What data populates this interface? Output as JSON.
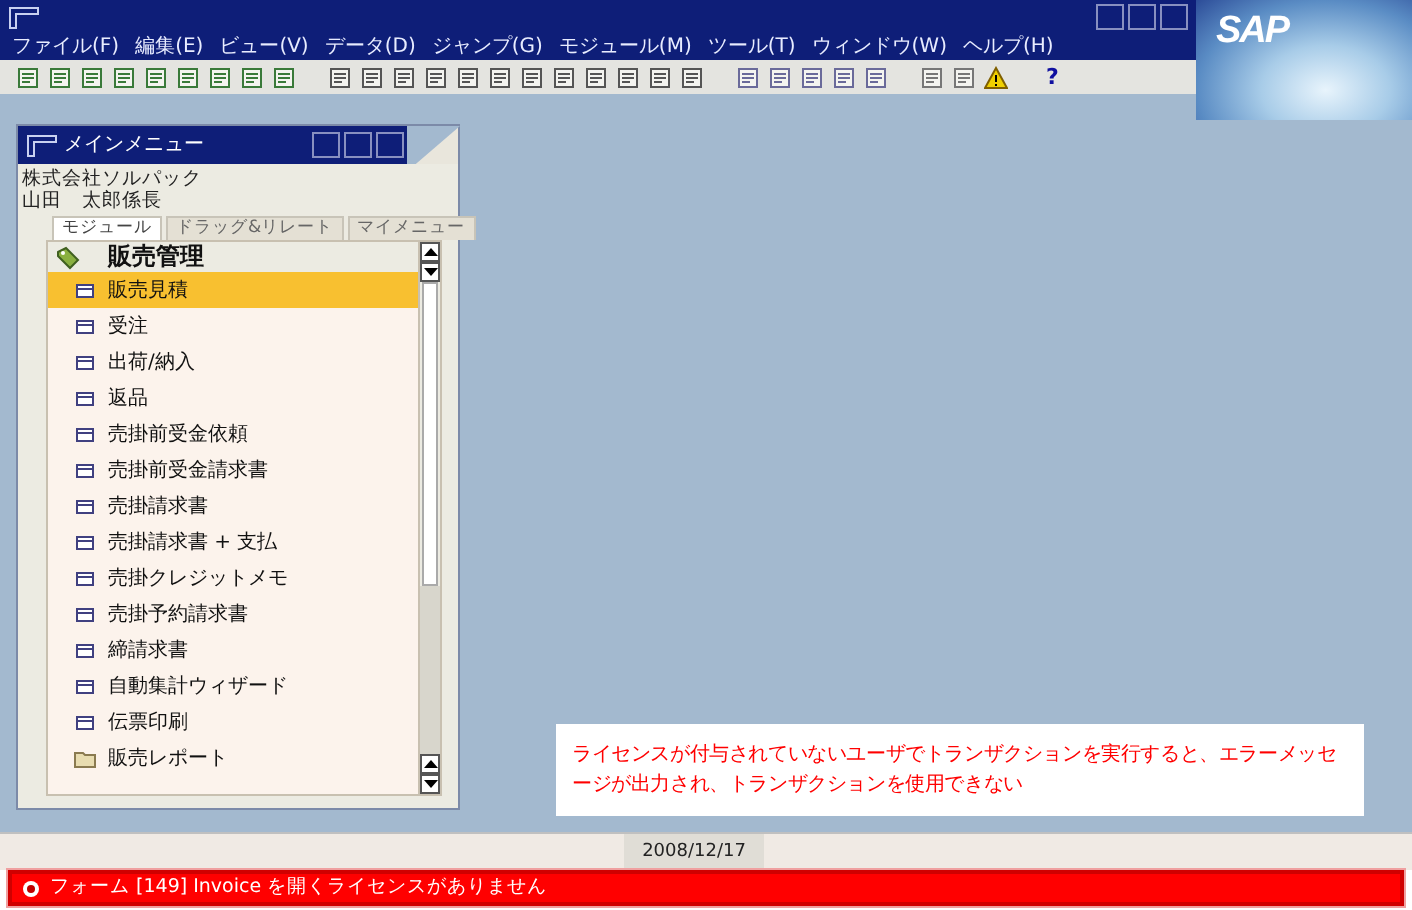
{
  "app": {
    "logo": "SAP"
  },
  "menu_bar": [
    {
      "label": "ファイル(F)"
    },
    {
      "label": "編集(E)"
    },
    {
      "label": "ビュー(V)"
    },
    {
      "label": "データ(D)"
    },
    {
      "label": "ジャンプ(G)"
    },
    {
      "label": "モジュール(M)"
    },
    {
      "label": "ツール(T)"
    },
    {
      "label": "ウィンドウ(W)"
    },
    {
      "label": "ヘルプ(H)"
    }
  ],
  "toolbar": {
    "help_label": "?"
  },
  "main_menu": {
    "title": "メインメニュー",
    "company": "株式会社ソルパック",
    "user": "山田　太郎係長",
    "tabs": [
      {
        "label": "モジュール",
        "selected": true
      },
      {
        "label": "ドラッグ&リレート",
        "selected": false
      },
      {
        "label": "マイメニュー",
        "selected": false
      }
    ],
    "tree": [
      {
        "label": "販売管理",
        "children": [
          {
            "label": "販売見積",
            "kind": "form",
            "selected": true
          },
          {
            "label": "受注",
            "kind": "form",
            "selected": false
          },
          {
            "label": "出荷/納入",
            "kind": "form",
            "selected": false
          },
          {
            "label": "返品",
            "kind": "form",
            "selected": false
          },
          {
            "label": "売掛前受金依頼",
            "kind": "form",
            "selected": false
          },
          {
            "label": "売掛前受金請求書",
            "kind": "form",
            "selected": false
          },
          {
            "label": "売掛請求書",
            "kind": "form",
            "selected": false
          },
          {
            "label": "売掛請求書 + 支払",
            "kind": "form",
            "selected": false
          },
          {
            "label": "売掛クレジットメモ",
            "kind": "form",
            "selected": false
          },
          {
            "label": "売掛予約請求書",
            "kind": "form",
            "selected": false
          },
          {
            "label": "締請求書",
            "kind": "form",
            "selected": false
          },
          {
            "label": "自動集計ウィザード",
            "kind": "form",
            "selected": false
          },
          {
            "label": "伝票印刷",
            "kind": "form",
            "selected": false
          },
          {
            "label": "販売レポート",
            "kind": "folder",
            "selected": false
          }
        ]
      }
    ]
  },
  "callout": "ライセンスが付与されていないユーザでトランザクションを実行すると、エラーメッセージが出力され、トランザクションを使用できない",
  "status_bar": {
    "date": "2008/12/17"
  },
  "error_bar": {
    "message": "フォーム [149] Invoice を開くライセンスがありません"
  }
}
